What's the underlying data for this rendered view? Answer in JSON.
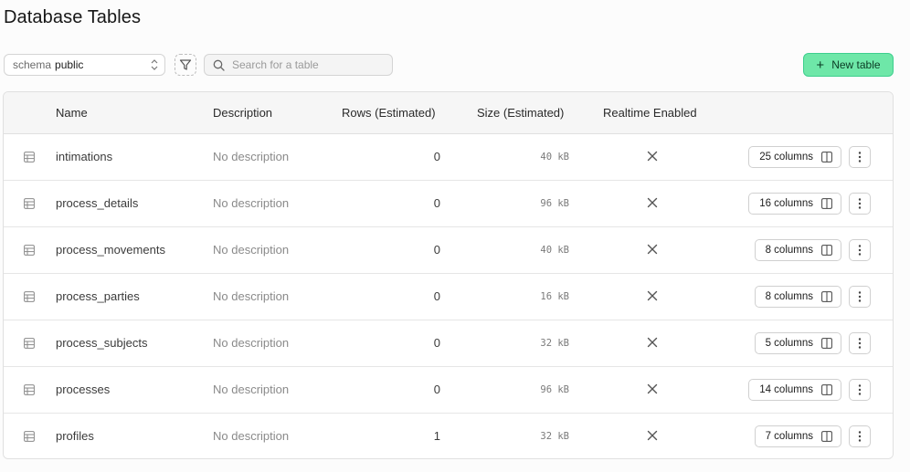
{
  "page": {
    "title": "Database Tables"
  },
  "toolbar": {
    "schema_label": "schema",
    "schema_value": "public",
    "search_placeholder": "Search for a table",
    "new_table_label": "New table"
  },
  "table": {
    "headers": {
      "name": "Name",
      "description": "Description",
      "rows": "Rows (Estimated)",
      "size": "Size (Estimated)",
      "realtime": "Realtime Enabled"
    },
    "rows": [
      {
        "name": "intimations",
        "description": "No description",
        "rows": "0",
        "size": "40 kB",
        "realtime": false,
        "columns": "25 columns"
      },
      {
        "name": "process_details",
        "description": "No description",
        "rows": "0",
        "size": "96 kB",
        "realtime": false,
        "columns": "16 columns"
      },
      {
        "name": "process_movements",
        "description": "No description",
        "rows": "0",
        "size": "40 kB",
        "realtime": false,
        "columns": "8 columns"
      },
      {
        "name": "process_parties",
        "description": "No description",
        "rows": "0",
        "size": "16 kB",
        "realtime": false,
        "columns": "8 columns"
      },
      {
        "name": "process_subjects",
        "description": "No description",
        "rows": "0",
        "size": "32 kB",
        "realtime": false,
        "columns": "5 columns"
      },
      {
        "name": "processes",
        "description": "No description",
        "rows": "0",
        "size": "96 kB",
        "realtime": false,
        "columns": "14 columns"
      },
      {
        "name": "profiles",
        "description": "No description",
        "rows": "1",
        "size": "32 kB",
        "realtime": false,
        "columns": "7 columns"
      }
    ]
  },
  "colors": {
    "accent": "#3ecf8e",
    "accent_fill": "#6ee7a8"
  },
  "icons": {
    "schema_chevron": "chevron-up-down-icon",
    "filter": "filter-icon",
    "search": "search-icon",
    "new_table": "plus-icon",
    "table_row": "table-icon",
    "realtime_disabled": "x-icon",
    "columns": "columns-icon",
    "more": "more-vertical-icon"
  }
}
